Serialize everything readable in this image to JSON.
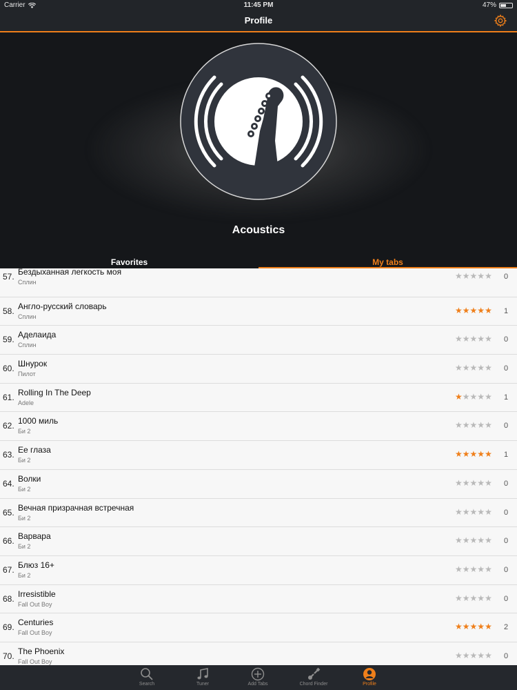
{
  "status": {
    "carrier": "Carrier",
    "time": "11:45 PM",
    "battery": "47%"
  },
  "navbar": {
    "title": "Profile"
  },
  "profile": {
    "name": "Acoustics"
  },
  "tabs": {
    "favorites": "Favorites",
    "my_tabs": "My tabs"
  },
  "accent": "#ef7f1a",
  "rows": [
    {
      "num": "57.",
      "title": "Бездыханная легкость моя",
      "artist": "Сплин",
      "rating": 0,
      "count": "0"
    },
    {
      "num": "58.",
      "title": "Англо-русский словарь",
      "artist": "Сплин",
      "rating": 5,
      "count": "1"
    },
    {
      "num": "59.",
      "title": "Аделаида",
      "artist": "Сплин",
      "rating": 0,
      "count": "0"
    },
    {
      "num": "60.",
      "title": "Шнурок",
      "artist": "Пилот",
      "rating": 0,
      "count": "0"
    },
    {
      "num": "61.",
      "title": "Rolling In The Deep",
      "artist": "Adele",
      "rating": 1,
      "count": "1"
    },
    {
      "num": "62.",
      "title": "1000 миль",
      "artist": "Би 2",
      "rating": 0,
      "count": "0"
    },
    {
      "num": "63.",
      "title": "Ее глаза",
      "artist": "Би 2",
      "rating": 5,
      "count": "1"
    },
    {
      "num": "64.",
      "title": "Волки",
      "artist": "Би 2",
      "rating": 0,
      "count": "0"
    },
    {
      "num": "65.",
      "title": "Вечная призрачная встречная",
      "artist": "Би 2",
      "rating": 0,
      "count": "0"
    },
    {
      "num": "66.",
      "title": "Варвара",
      "artist": "Би 2",
      "rating": 0,
      "count": "0"
    },
    {
      "num": "67.",
      "title": "Блюз 16+",
      "artist": "Би 2",
      "rating": 0,
      "count": "0"
    },
    {
      "num": "68.",
      "title": "Irresistible",
      "artist": "Fall Out Boy",
      "rating": 0,
      "count": "0"
    },
    {
      "num": "69.",
      "title": "Centuries",
      "artist": "Fall Out Boy",
      "rating": 5,
      "count": "2"
    },
    {
      "num": "70.",
      "title": "The Phoenix",
      "artist": "Fall Out Boy",
      "rating": 0,
      "count": "0"
    }
  ],
  "tabbar": [
    {
      "label": "Search",
      "icon": "search-icon",
      "active": false
    },
    {
      "label": "Tuner",
      "icon": "music-note-icon",
      "active": false
    },
    {
      "label": "Add Tabs",
      "icon": "add-icon",
      "active": false
    },
    {
      "label": "Chord Finder",
      "icon": "guitar-icon",
      "active": false
    },
    {
      "label": "Profile",
      "icon": "profile-icon",
      "active": true
    }
  ]
}
